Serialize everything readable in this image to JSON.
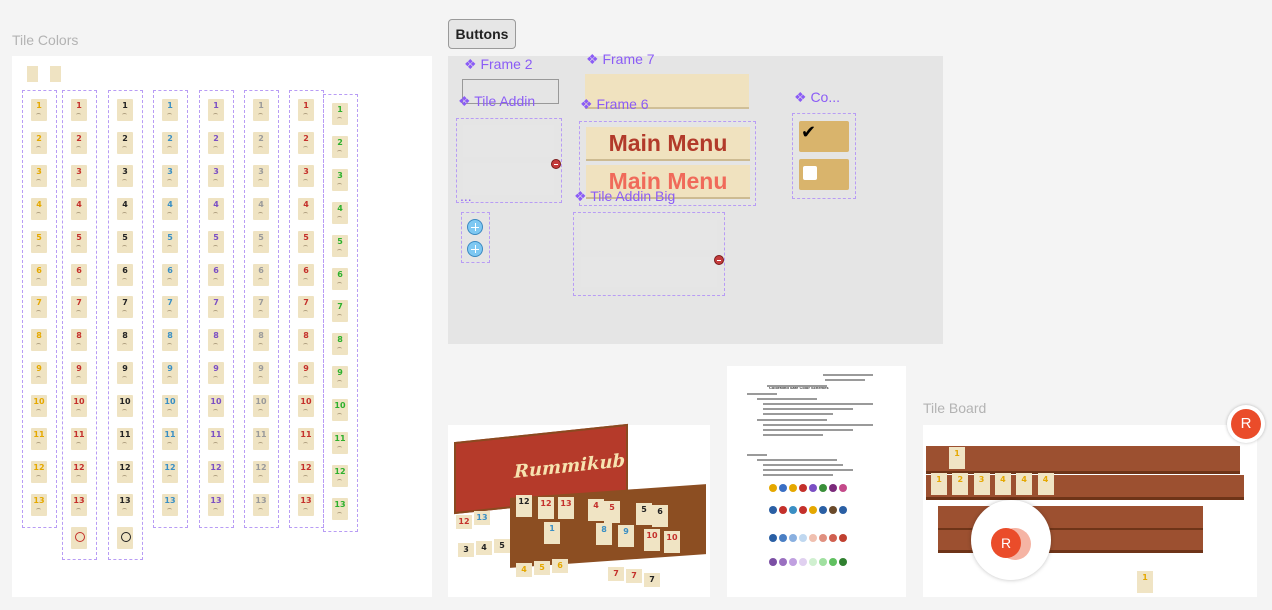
{
  "labels": {
    "tile_colors": "Tile Colors",
    "buttons": "Buttons",
    "tile_board": "Tile Board"
  },
  "components": {
    "frame2": "❖ Frame 2",
    "frame7": "❖ Frame 7",
    "tile_addin": "❖ Tile Addin",
    "frame6": "❖ Frame 6",
    "co": "❖ Co...",
    "tile_addin_big": "❖ Tile Addin Big",
    "ellipsis": "..."
  },
  "menu": {
    "main_menu": "Main Menu",
    "main_menu_hover": "Main Menu"
  },
  "tile_numbers": [
    "1",
    "2",
    "3",
    "4",
    "5",
    "6",
    "7",
    "8",
    "9",
    "10",
    "11",
    "12",
    "13"
  ],
  "tile_column_colors": [
    "#e5a800",
    "#c4302b",
    "#222222",
    "#3a8fc4",
    "#7b4fc4",
    "#9a9a9a",
    "#c4302b",
    "#2db02d"
  ],
  "columns_with_joker": [
    1,
    2
  ],
  "board": {
    "top_single": "1",
    "row_tiles": [
      "1",
      "2",
      "3",
      "4",
      "4",
      "4"
    ],
    "bottom_single": "1"
  },
  "avatar": {
    "letter": "R",
    "color": "#ea4c2a"
  },
  "photo": {
    "brand": "Rummikub",
    "rack_tiles": [
      "12",
      "12",
      "13",
      "4",
      "5",
      "5",
      "6",
      "1",
      "8",
      "9",
      "10",
      "10"
    ],
    "loose_tiles": [
      "12",
      "13",
      "3",
      "4",
      "5",
      "4",
      "5",
      "6",
      "7",
      "7",
      "7"
    ]
  },
  "document": {
    "title": "ColorMind Safe Color Schemes"
  }
}
